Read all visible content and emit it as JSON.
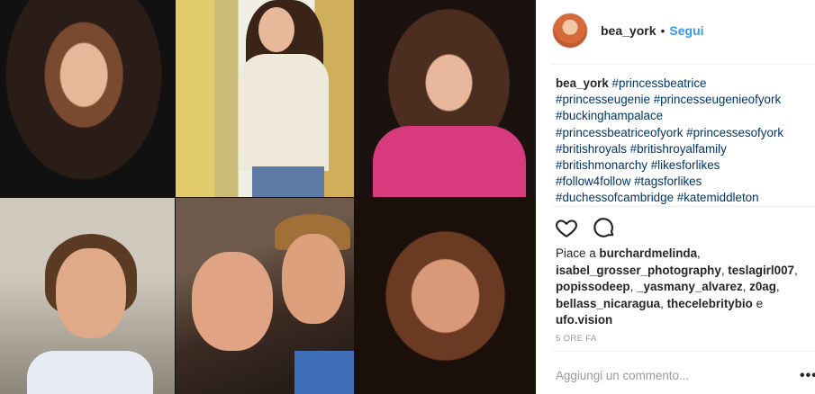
{
  "post": {
    "username": "bea_york",
    "separator": "•",
    "follow_label": "Segui",
    "caption": {
      "username": "bea_york",
      "hashtags": [
        "#princessbeatrice",
        "#princesseugenie",
        "#princesseugenieofyork",
        "#buckinghampalace",
        "#princessbeatriceofyork",
        "#princessesofyork",
        "#britishroyals",
        "#britishroyalfamily",
        "#britishmonarchy",
        "#likesforlikes",
        "#follow4follow",
        "#tagsforlikes",
        "#duchessofcambridge",
        "#katemiddleton"
      ]
    },
    "likes": {
      "prefix": "Piace a",
      "users": [
        "burchardmelinda",
        "isabel_grosser_photography",
        "teslagirl007",
        "popissodeep",
        "_yasmany_alvarez",
        "z0ag",
        "bellass_nicaragua",
        "thecelebritybio",
        "ufo.vision"
      ],
      "conjunction": "e"
    },
    "timestamp": "5 ORE FA",
    "comment_placeholder": "Aggiungi un commento...",
    "more_label": "•••"
  },
  "icons": {
    "like": "heart-icon",
    "comment": "comment-bubble-icon"
  },
  "colors": {
    "link": "#3897f0",
    "hashtag": "#003569",
    "text": "#262626",
    "muted": "#999999"
  }
}
